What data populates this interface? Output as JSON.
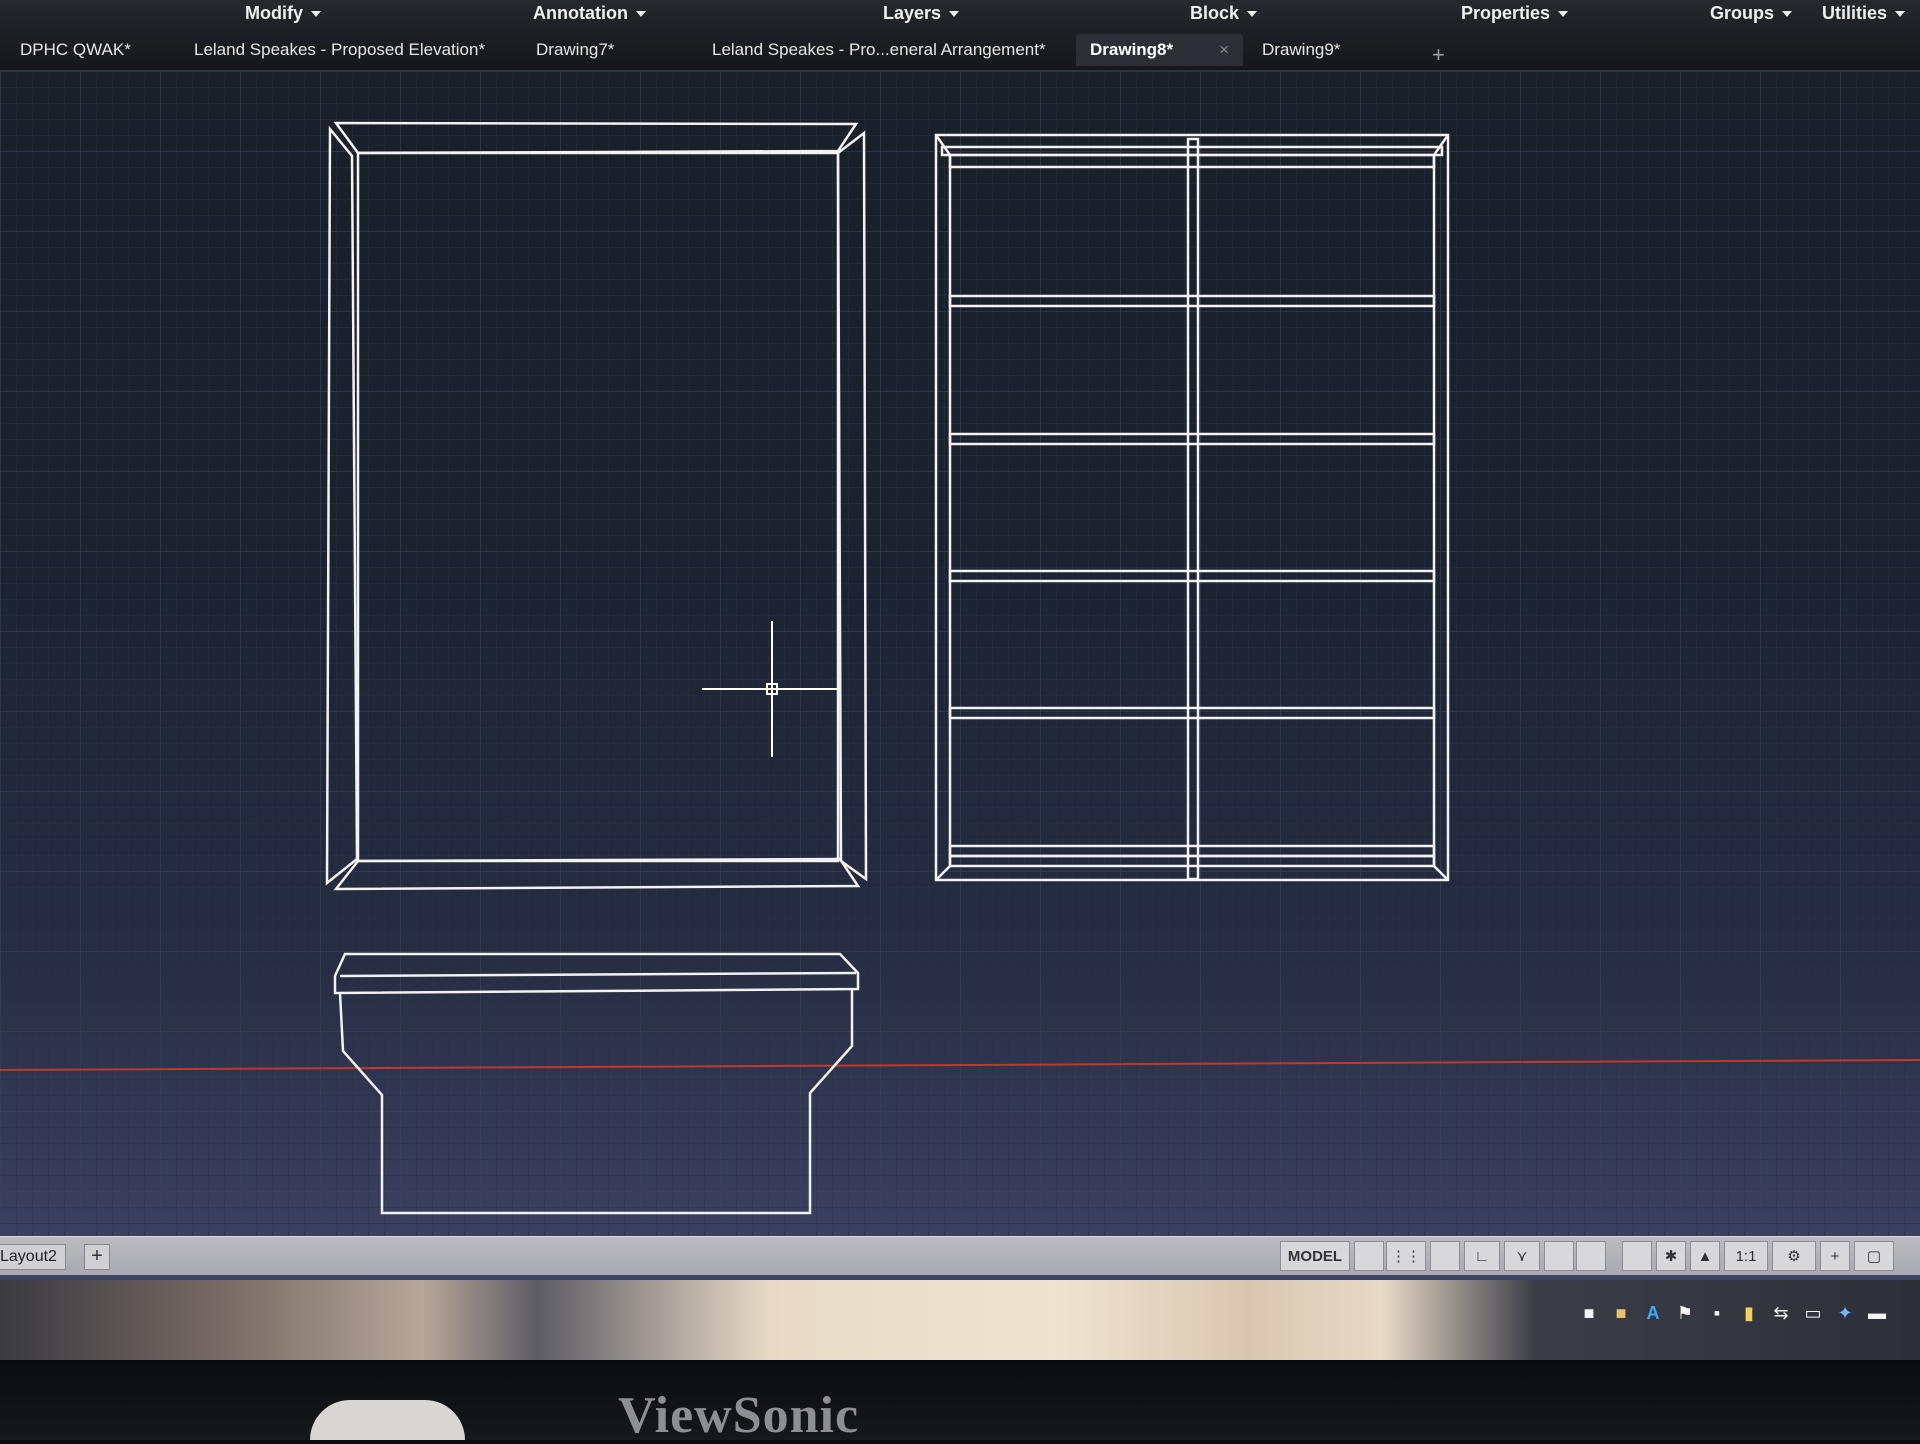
{
  "ribbon": {
    "panels": [
      "Modify",
      "Annotation",
      "Layers",
      "Block",
      "Properties",
      "Groups",
      "Utilities"
    ]
  },
  "tabs": {
    "items": [
      {
        "label": "DPHC QWAK*",
        "active": false
      },
      {
        "label": "Leland Speakes - Proposed Elevation*",
        "active": false
      },
      {
        "label": "Drawing7*",
        "active": false
      },
      {
        "label": "Leland Speakes - Pro...eneral Arrangement*",
        "active": false
      },
      {
        "label": "Drawing8*",
        "active": true
      },
      {
        "label": "Drawing9*",
        "active": false
      }
    ],
    "close_glyph": "×",
    "new_tab_glyph": "+"
  },
  "layout_tabs": {
    "current": "Layout2",
    "add_glyph": "+"
  },
  "status_bar": {
    "model": "MODEL",
    "scale": "1:1"
  },
  "taskbar": {
    "tray_icons": [
      "notification-icon",
      "folder-icon",
      "autocad-icon",
      "flag-icon",
      "window-icon",
      "note-icon",
      "network-icon",
      "chat-icon",
      "app-icon",
      "keyboard-icon"
    ]
  },
  "monitor": {
    "brand": "ViewSonic"
  },
  "colors": {
    "linework": "#f2f2f2",
    "grid": "#3a4356",
    "axis_x": "#c0392b"
  }
}
